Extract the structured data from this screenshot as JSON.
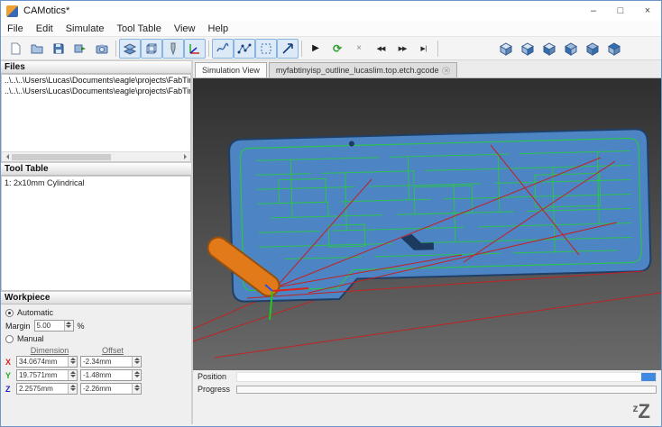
{
  "window": {
    "title": "CAMotics*",
    "controls": {
      "minimize": "–",
      "maximize": "□",
      "close": "×"
    }
  },
  "menu_bar": {
    "items": [
      "File",
      "Edit",
      "Simulate",
      "Tool Table",
      "View",
      "Help"
    ]
  },
  "toolbar": {
    "buttons": [
      "new-project",
      "open-project",
      "save-project",
      "export",
      "snapshot",
      "toggle-surface",
      "toggle-workpiece",
      "toggle-tool",
      "toggle-axes",
      "toggle-smooth-path",
      "toggle-path-lines",
      "toggle-bounds",
      "toggle-direction",
      "play",
      "reload",
      "stop",
      "rewind",
      "fast-forward",
      "skip-to-end",
      "view-isometric",
      "view-front",
      "view-back",
      "view-left",
      "view-right",
      "view-top"
    ],
    "glyphs": {
      "play": "▶",
      "reload": "⟳",
      "stop": "×",
      "rewind": "◀◀",
      "fast_forward": "▶▶",
      "skip": "▶|"
    }
  },
  "files_panel": {
    "title": "Files",
    "items": [
      "..\\..\\..\\Users\\Lucas\\Documents\\eagle\\projects\\FabTinyISP\\myfab",
      "..\\..\\..\\Users\\Lucas\\Documents\\eagle\\projects\\FabTinyISP\\myfab"
    ]
  },
  "tool_table_panel": {
    "title": "Tool Table",
    "items": [
      "1: 2x10mm Cylindrical"
    ]
  },
  "workpiece_panel": {
    "title": "Workpiece",
    "automatic_label": "Automatic",
    "margin_label": "Margin",
    "margin_value": "5.00",
    "margin_unit": "%",
    "manual_label": "Manual",
    "col_dimension": "Dimension",
    "col_offset": "Offset",
    "rows": [
      {
        "axis": "X",
        "dimension": "34.0674mm",
        "offset": "-2.34mm",
        "color": "#cc2222"
      },
      {
        "axis": "Y",
        "dimension": "19.7571mm",
        "offset": "-1.48mm",
        "color": "#22aa22"
      },
      {
        "axis": "Z",
        "dimension": "2.2575mm",
        "offset": "-2.26mm",
        "color": "#2222cc"
      }
    ]
  },
  "tabs": [
    {
      "label": "Simulation View",
      "active": true
    },
    {
      "label": "myfabtinyisp_outline_lucaslim.top.etch.gcode",
      "active": false
    }
  ],
  "icons": {
    "tab_close": "×"
  },
  "statusbar": {
    "position_label": "Position",
    "progress_label": "Progress"
  },
  "logo": {
    "small": "z",
    "big": "Z"
  },
  "colors": {
    "board": "#4c84c4",
    "toolpath": "#2ec24e",
    "rapid": "#c22222",
    "tool": "#e27a1a",
    "viewport_bg": "#3a3a3a",
    "position_fill": "#3f8ae0"
  }
}
